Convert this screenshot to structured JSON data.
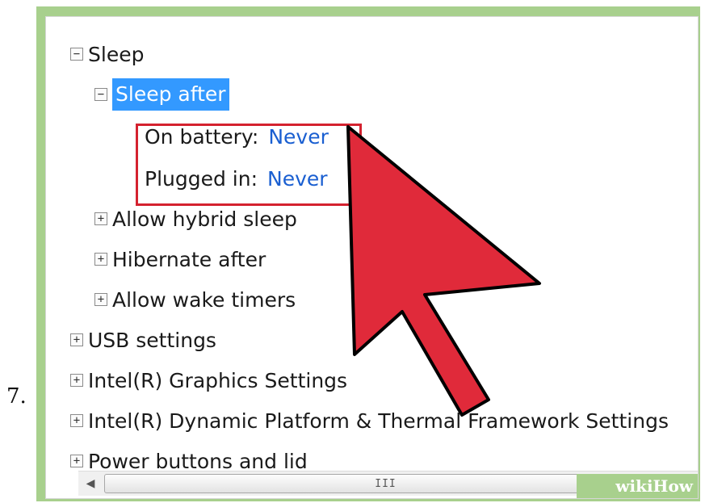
{
  "step_number": "7.",
  "tree": {
    "sleep": {
      "label": "Sleep",
      "toggle": "−"
    },
    "sleep_after": {
      "label": "Sleep after",
      "toggle": "−"
    },
    "on_battery": {
      "label": "On battery:",
      "value": "Never"
    },
    "plugged_in": {
      "label": "Plugged in:",
      "value": "Never"
    },
    "allow_hybrid_sleep": {
      "label": "Allow hybrid sleep",
      "toggle": "+"
    },
    "hibernate_after": {
      "label": "Hibernate after",
      "toggle": "+"
    },
    "allow_wake_timers": {
      "label": "Allow wake timers",
      "toggle": "+"
    },
    "usb_settings": {
      "label": "USB settings",
      "toggle": "+"
    },
    "intel_graphics": {
      "label": "Intel(R) Graphics Settings",
      "toggle": "+"
    },
    "intel_dptf": {
      "label": "Intel(R) Dynamic Platform & Thermal Framework Settings",
      "toggle": "+"
    },
    "power_buttons": {
      "label": "Power buttons and lid",
      "toggle": "+"
    }
  },
  "scrollbar": {
    "left_arrow": "◀",
    "right_arrow": "▶",
    "grip": "III"
  },
  "watermark": {
    "wiki": "wiki",
    "how": "How"
  },
  "colors": {
    "selection": "#3399ff",
    "value": "#1a5fd1",
    "highlight_box": "#d4222f",
    "cursor": "#e02a3a",
    "frame": "#a8d08d"
  },
  "icons": {
    "collapse": "minus-box-icon",
    "expand": "plus-box-icon",
    "pointer": "mouse-cursor-icon"
  }
}
